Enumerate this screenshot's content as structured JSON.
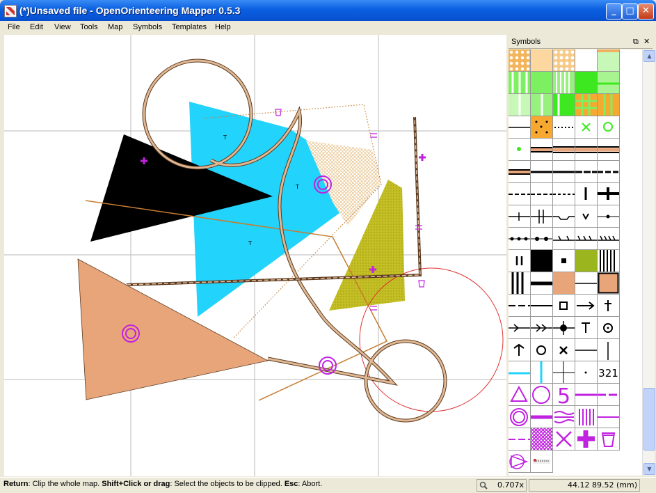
{
  "window": {
    "title": "(*)Unsaved file - OpenOrienteering Mapper 0.5.3",
    "minimize_glyph": "_",
    "maximize_glyph": "□",
    "close_glyph": "✕"
  },
  "menu": [
    "File",
    "Edit",
    "View",
    "Tools",
    "Map",
    "Symbols",
    "Templates",
    "Help"
  ],
  "symbols_panel": {
    "title": "Symbols",
    "float_glyph": "⧉",
    "close_glyph": "✕",
    "number_label": "321",
    "five_label": "5"
  },
  "map_labels": {
    "t": "T"
  },
  "scrollbar": {
    "up": "▲",
    "down": "▼"
  },
  "status": {
    "k1": "Return",
    "t1": ": Clip the whole map. ",
    "k2": "Shift+Click or drag",
    "t2": ": Select the objects to be clipped. ",
    "k3": "Esc",
    "t3": ": Abort.",
    "zoom": "0.707x",
    "coords": "44.12 89.52 (mm)"
  },
  "colors": {
    "cyan": "#22d3fb",
    "tan": "#e8a57a",
    "olive": "#c4bf25",
    "purple": "#c022e0",
    "red": "#e03030",
    "brown": "#c77b2e",
    "green": "#55f034"
  }
}
